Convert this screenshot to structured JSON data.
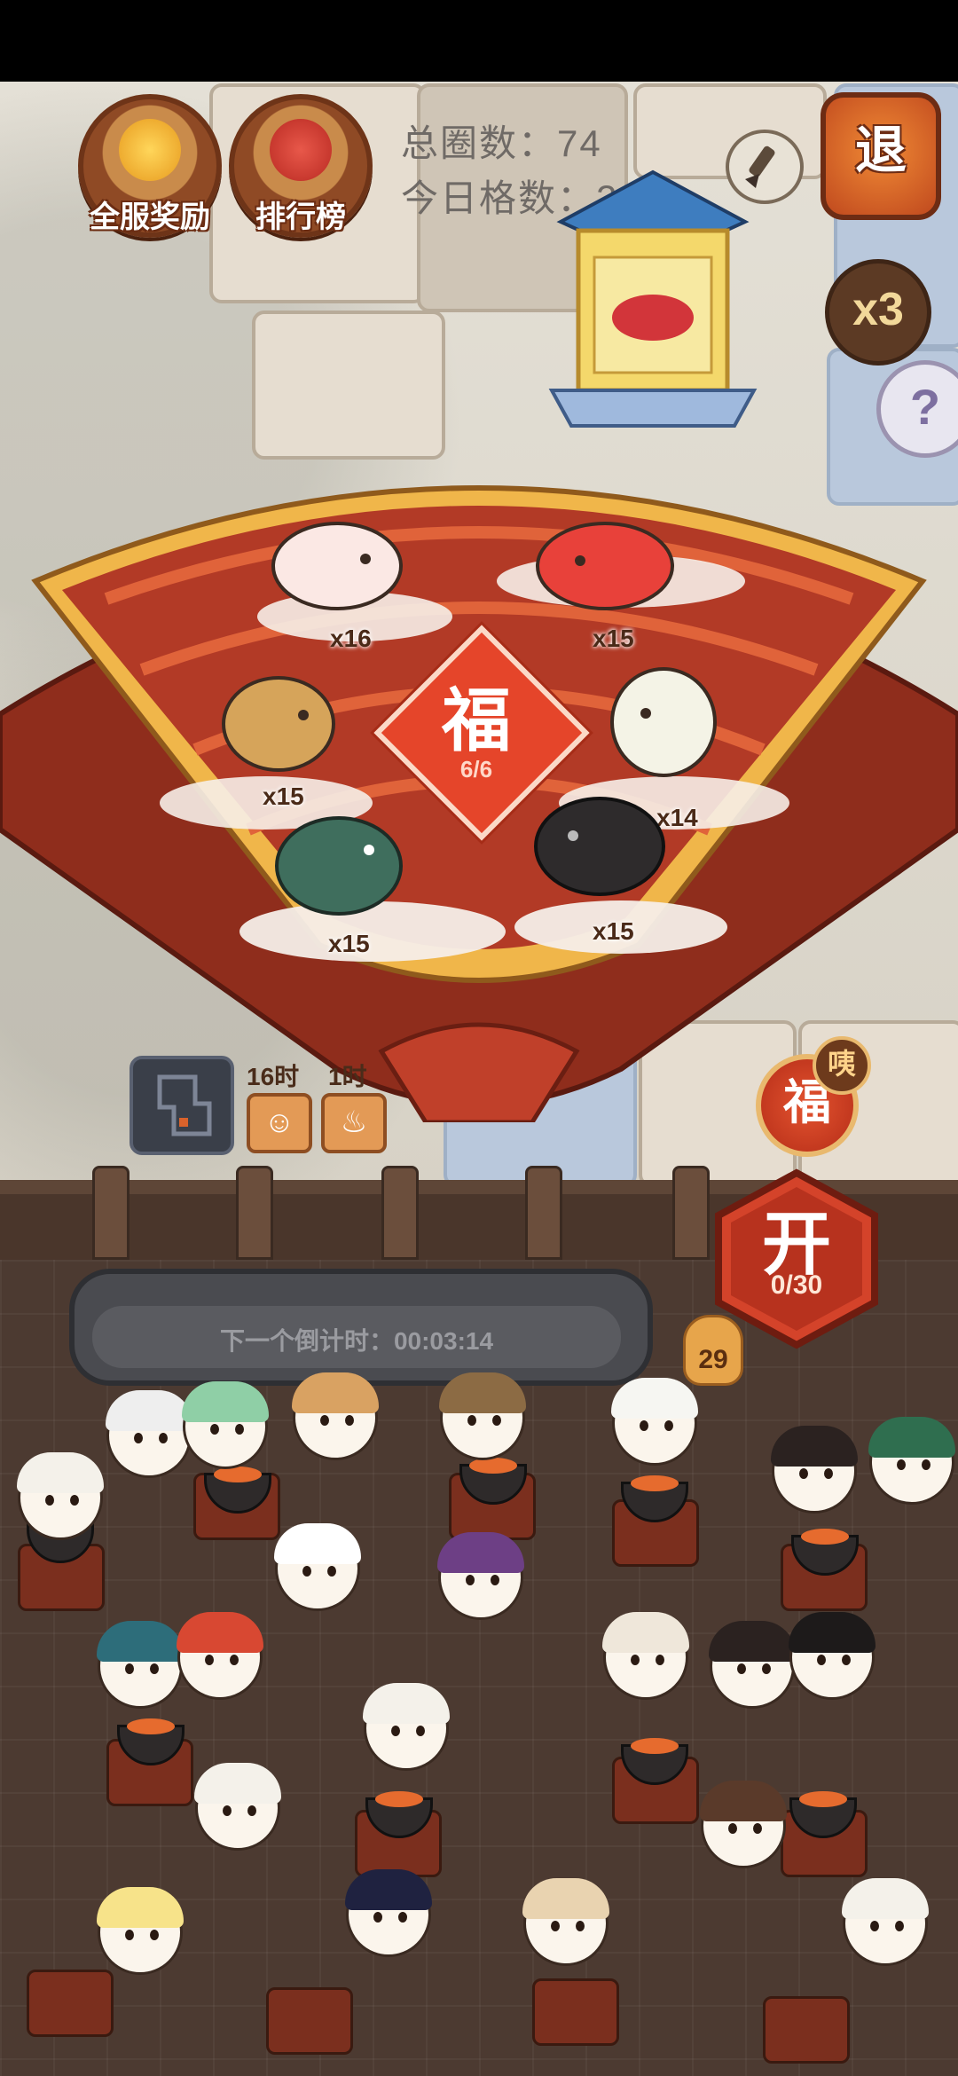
{
  "hud": {
    "server_reward_label": "全服奖励",
    "leaderboard_label": "排行榜",
    "total_laps": "总圈数：74",
    "today_steps": "今日格数：237",
    "exit_label": "退",
    "speed_label": "x3",
    "help_label": "?"
  },
  "fan": {
    "center_char": "福",
    "center_progress": "6/6",
    "horses": [
      {
        "name": "white-horse",
        "count": "x16",
        "color": "#fbe8e4"
      },
      {
        "name": "red-horse",
        "count": "x15",
        "color": "#e8413a"
      },
      {
        "name": "tan-horse",
        "count": "x15",
        "color": "#d6a45a"
      },
      {
        "name": "cream-horse",
        "count": "x14",
        "color": "#f4f3e6"
      },
      {
        "name": "green-horse",
        "count": "x15",
        "color": "#3f6e5d"
      },
      {
        "name": "black-horse",
        "count": "x15",
        "color": "#2e2b2c"
      }
    ]
  },
  "controls": {
    "timer_a_label": "16时",
    "timer_b_label": "1时",
    "fu_button": "福",
    "fu_badge": "咦",
    "open_label": "开",
    "open_count": "0/30",
    "coin_count": "29"
  },
  "countdown": {
    "text": "下一个倒计时：00:03:14"
  },
  "colors": {
    "fan_red": "#b23a26",
    "fan_gold": "#f0b64a",
    "accent_orange": "#e5452a"
  }
}
